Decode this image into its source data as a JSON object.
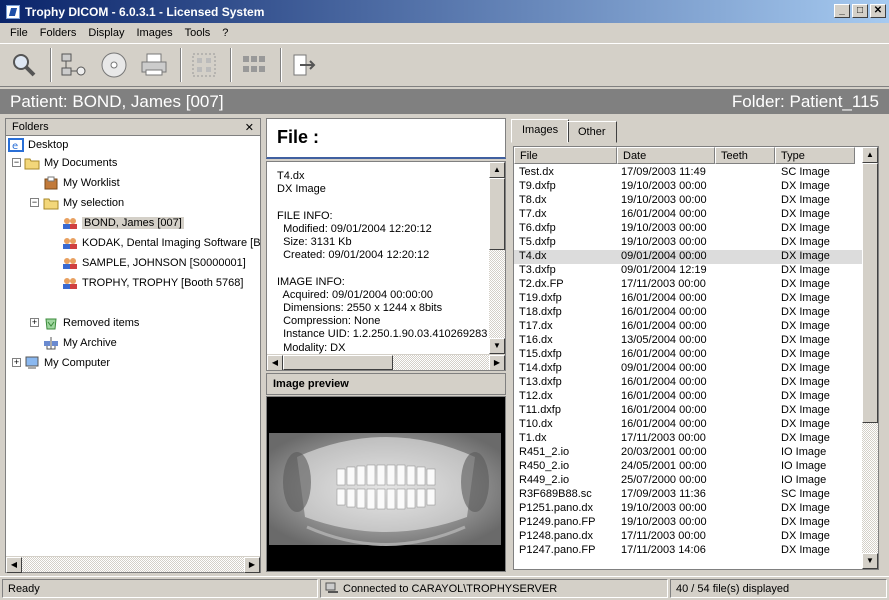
{
  "window": {
    "title": "Trophy DICOM - 6.0.3.1 - Licensed System",
    "min": "_",
    "max": "□",
    "close": "✕"
  },
  "menu": [
    "File",
    "Folders",
    "Display",
    "Images",
    "Tools",
    "?"
  ],
  "infobar": {
    "patient": "Patient: BOND, James [007]",
    "folder": "Folder: Patient_115"
  },
  "folders": {
    "title": "Folders",
    "close": "✕",
    "tree": [
      {
        "label": "Desktop",
        "icon": "desktop-icon"
      },
      {
        "label": "My Documents",
        "icon": "folder-open-icon"
      },
      {
        "label": "My Worklist",
        "icon": "worklist-icon"
      },
      {
        "label": "My selection",
        "icon": "folder-open-icon"
      },
      {
        "label": "BOND, James [007]",
        "icon": "patient-icon"
      },
      {
        "label": "KODAK, Dental Imaging Software [Bo",
        "icon": "patient-icon"
      },
      {
        "label": "SAMPLE, JOHNSON [S0000001]",
        "icon": "patient-icon"
      },
      {
        "label": "TROPHY, TROPHY [Booth 5768]",
        "icon": "patient-icon"
      },
      {
        "label": "Removed items",
        "icon": "recycle-icon"
      },
      {
        "label": "My Archive",
        "icon": "archive-icon"
      },
      {
        "label": "My Computer",
        "icon": "computer-icon"
      }
    ]
  },
  "file": {
    "heading": "File :",
    "info": "T4.dx\nDX Image\n\nFILE INFO:\n  Modified: 09/01/2004 12:20:12\n  Size: 3131 Kb\n  Created: 09/01/2004 12:20:12\n\nIMAGE INFO:\n  Acquired: 09/01/2004 00:00:00\n  Dimensions: 2550 x 1244 x 8bits\n  Compression: None\n  Instance UID: 1.2.250.1.90.03.410269283\n  Modality: DX",
    "preview_title": "Image preview"
  },
  "tabs": [
    "Images",
    "Other"
  ],
  "list": {
    "columns": [
      "File",
      "Date",
      "Teeth",
      "Type"
    ],
    "selected_index": 6,
    "rows": [
      [
        "Test.dx",
        "17/09/2003 11:49",
        "",
        "SC Image"
      ],
      [
        "T9.dxfp",
        "19/10/2003 00:00",
        "",
        "DX Image"
      ],
      [
        "T8.dx",
        "19/10/2003 00:00",
        "",
        "DX Image"
      ],
      [
        "T7.dx",
        "16/01/2004 00:00",
        "",
        "DX Image"
      ],
      [
        "T6.dxfp",
        "19/10/2003 00:00",
        "",
        "DX Image"
      ],
      [
        "T5.dxfp",
        "19/10/2003 00:00",
        "",
        "DX Image"
      ],
      [
        "T4.dx",
        "09/01/2004 00:00",
        "",
        "DX Image"
      ],
      [
        "T3.dxfp",
        "09/01/2004 12:19",
        "",
        "DX Image"
      ],
      [
        "T2.dx.FP",
        "17/11/2003 00:00",
        "",
        "DX Image"
      ],
      [
        "T19.dxfp",
        "16/01/2004 00:00",
        "",
        "DX Image"
      ],
      [
        "T18.dxfp",
        "16/01/2004 00:00",
        "",
        "DX Image"
      ],
      [
        "T17.dx",
        "16/01/2004 00:00",
        "",
        "DX Image"
      ],
      [
        "T16.dx",
        "13/05/2004 00:00",
        "",
        "DX Image"
      ],
      [
        "T15.dxfp",
        "16/01/2004 00:00",
        "",
        "DX Image"
      ],
      [
        "T14.dxfp",
        "09/01/2004 00:00",
        "",
        "DX Image"
      ],
      [
        "T13.dxfp",
        "16/01/2004 00:00",
        "",
        "DX Image"
      ],
      [
        "T12.dx",
        "16/01/2004 00:00",
        "",
        "DX Image"
      ],
      [
        "T11.dxfp",
        "16/01/2004 00:00",
        "",
        "DX Image"
      ],
      [
        "T10.dx",
        "16/01/2004 00:00",
        "",
        "DX Image"
      ],
      [
        "T1.dx",
        "17/11/2003 00:00",
        "",
        "DX Image"
      ],
      [
        "R451_2.io",
        "20/03/2001 00:00",
        "",
        "IO Image"
      ],
      [
        "R450_2.io",
        "24/05/2001 00:00",
        "",
        "IO Image"
      ],
      [
        "R449_2.io",
        "25/07/2000 00:00",
        "",
        "IO Image"
      ],
      [
        "R3F689B88.sc",
        "17/09/2003 11:36",
        "",
        "SC Image"
      ],
      [
        "P1251.pano.dx",
        "19/10/2003 00:00",
        "",
        "DX Image"
      ],
      [
        "P1249.pano.FP",
        "19/10/2003 00:00",
        "",
        "DX Image"
      ],
      [
        "P1248.pano.dx",
        "17/11/2003 00:00",
        "",
        "DX Image"
      ],
      [
        "P1247.pano.FP",
        "17/11/2003 14:06",
        "",
        "DX Image"
      ]
    ]
  },
  "status": {
    "left": "Ready",
    "connection": "Connected to CARAYOL\\TROPHYSERVER",
    "count": "40 / 54 file(s) displayed"
  },
  "colors": {
    "title_start": "#0a246a",
    "title_end": "#a6caf0",
    "infobar": "#808080",
    "face": "#d4d0c8"
  }
}
